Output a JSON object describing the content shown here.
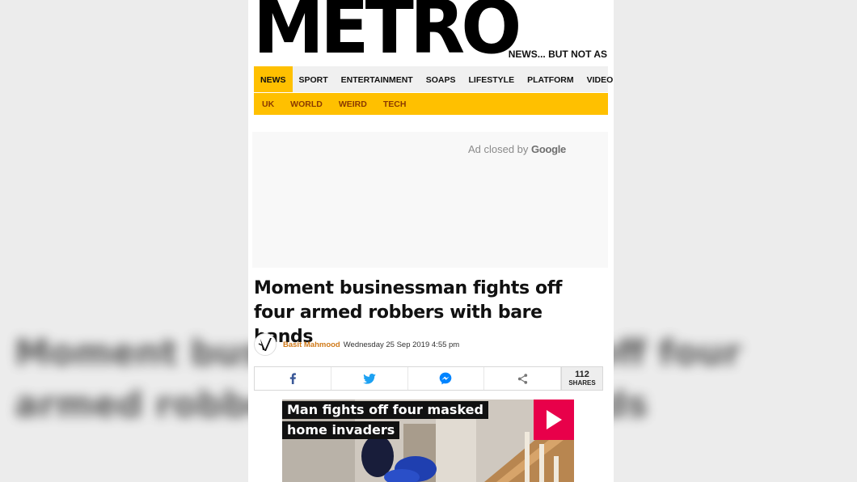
{
  "brand": {
    "logo_text": "METRO",
    "tagline": "NEWS... BUT NOT AS"
  },
  "nav": {
    "primary": [
      {
        "label": "NEWS",
        "active": true
      },
      {
        "label": "SPORT",
        "active": false
      },
      {
        "label": "ENTERTAINMENT",
        "active": false
      },
      {
        "label": "SOAPS",
        "active": false
      },
      {
        "label": "LIFESTYLE",
        "active": false
      },
      {
        "label": "PLATFORM",
        "active": false
      },
      {
        "label": "VIDEO",
        "active": false
      }
    ],
    "secondary": [
      "UK",
      "WORLD",
      "WEIRD",
      "TECH"
    ]
  },
  "ad": {
    "text": "Ad closed by",
    "brand": "Google"
  },
  "article": {
    "headline": "Moment businessman fights off four armed robbers with bare hands",
    "author": "Basit Mahmood",
    "date": "Wednesday 25 Sep 2019 4:55 pm"
  },
  "share": {
    "buttons": [
      "facebook-icon",
      "twitter-icon",
      "messenger-icon",
      "share-icon"
    ],
    "count": "112",
    "count_label": "SHARES"
  },
  "video": {
    "title": "Man fights off four masked home invaders"
  },
  "background": {
    "blurred_text": "Moment businessman fights off four armed robbers with bare hands"
  },
  "colors": {
    "nav_active": "#ffc000",
    "secondary_bar": "#ffc000",
    "author": "#d07a1a",
    "play_button": "#e8004a",
    "facebook": "#3b5998",
    "twitter": "#1da1f2",
    "messenger": "#0084ff"
  }
}
